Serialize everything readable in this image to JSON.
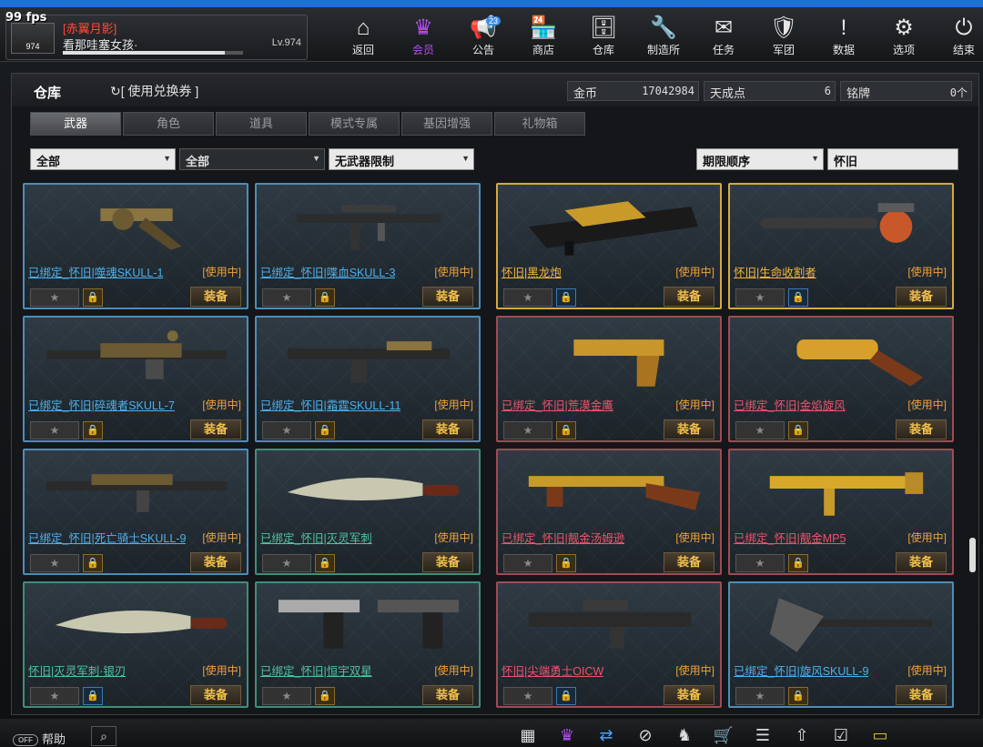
{
  "fps": "99 fps",
  "player": {
    "name": "[赤翼月影]",
    "sub": "看那哇塞女孩·",
    "level": "Lv.974",
    "avatar_level": "974"
  },
  "nav": [
    {
      "icon": "⌂",
      "label": "返回",
      "name": "back"
    },
    {
      "icon": "♛",
      "label": "会员",
      "name": "member"
    },
    {
      "icon": "📢",
      "label": "公告",
      "name": "notice",
      "badge": "23"
    },
    {
      "icon": "🏪",
      "label": "商店",
      "name": "shop"
    },
    {
      "icon": "🗄",
      "label": "仓库",
      "name": "storage"
    },
    {
      "icon": "🔧",
      "label": "制造所",
      "name": "workshop"
    },
    {
      "icon": "✉",
      "label": "任务",
      "name": "mission"
    },
    {
      "icon": "🛡",
      "label": "军团",
      "name": "clan"
    },
    {
      "icon": "!",
      "label": "数据",
      "name": "stats"
    },
    {
      "icon": "⚙",
      "label": "选项",
      "name": "options"
    },
    {
      "icon": "⏻",
      "label": "结束",
      "name": "exit"
    }
  ],
  "storage": {
    "title": "仓库",
    "coupon": "[ 使用兑换券 ]",
    "currency": [
      {
        "k": "金币",
        "v": "17042984"
      },
      {
        "k": "天成点",
        "v": "6"
      },
      {
        "k": "铭牌",
        "v": "0个"
      }
    ]
  },
  "tabs": [
    "武器",
    "角色",
    "道具",
    "模式专属",
    "基因增强",
    "礼物箱"
  ],
  "filters": {
    "f1": "全部",
    "f2": "全部",
    "f3": "无武器限制",
    "sort": "期限顺序",
    "search": "怀旧"
  },
  "items": [
    {
      "name": "已绑定_怀旧|噬魂SKULL-1",
      "status": "[使用中]",
      "equip": "装备",
      "star": "★",
      "border": "blue",
      "lock": "gold",
      "gun": "revolver"
    },
    {
      "name": "已绑定_怀旧|喋血SKULL-3",
      "status": "[使用中]",
      "equip": "装备",
      "star": "★",
      "border": "blue",
      "lock": "gold",
      "gun": "smg"
    },
    {
      "name": "怀旧|黑龙炮",
      "status": "[使用中]",
      "equip": "装备",
      "star": "★",
      "border": "gold",
      "lock": "blue",
      "gun": "cannon"
    },
    {
      "name": "怀旧|生命收割者",
      "status": "[使用中]",
      "equip": "装备",
      "star": "★",
      "border": "gold",
      "lock": "blue",
      "gun": "chainsaw"
    },
    {
      "name": "已绑定_怀旧|碎魂者SKULL-7",
      "status": "[使用中]",
      "equip": "装备",
      "star": "★",
      "border": "blue",
      "lock": "gold",
      "gun": "mg"
    },
    {
      "name": "已绑定_怀旧|霜霆SKULL-11",
      "status": "[使用中]",
      "equip": "装备",
      "star": "★",
      "border": "blue",
      "lock": "gold",
      "gun": "shotgun"
    },
    {
      "name": "已绑定_怀旧|荒漠金鹰",
      "status": "[使用中]",
      "equip": "装备",
      "star": "★",
      "border": "red",
      "lock": "gold",
      "gun": "pistol"
    },
    {
      "name": "已绑定_怀旧|金焰旋风",
      "status": "[使用中]",
      "equip": "装备",
      "star": "★",
      "border": "red",
      "lock": "gold",
      "gun": "launcher"
    },
    {
      "name": "已绑定_怀旧|死亡骑士SKULL-9",
      "status": "[使用中]",
      "equip": "装备",
      "star": "★",
      "border": "blue",
      "lock": "gold",
      "gun": "rifle"
    },
    {
      "name": "已绑定_怀旧|灭灵军刺",
      "status": "[使用中]",
      "equip": "装备",
      "star": "★",
      "border": "green",
      "lock": "gold",
      "gun": "knife"
    },
    {
      "name": "已绑定_怀旧|靓金汤姆逊",
      "status": "[使用中]",
      "equip": "装备",
      "star": "★",
      "border": "red",
      "lock": "gold",
      "gun": "thompson"
    },
    {
      "name": "已绑定_怀旧|靓金MP5",
      "status": "[使用中]",
      "equip": "装备",
      "star": "★",
      "border": "red",
      "lock": "gold",
      "gun": "mp5"
    },
    {
      "name": "怀旧|灭灵军刺·银刃",
      "status": "[使用中]",
      "equip": "装备",
      "star": "★",
      "border": "green",
      "lock": "blue",
      "gun": "knife"
    },
    {
      "name": "已绑定_怀旧|恒宇双星",
      "status": "[使用中]",
      "equip": "装备",
      "star": "★",
      "border": "green",
      "lock": "gold",
      "gun": "dual"
    },
    {
      "name": "怀旧|尖端勇士OICW",
      "status": "[使用中]",
      "equip": "装备",
      "star": "★",
      "border": "red",
      "lock": "blue",
      "gun": "oicw"
    },
    {
      "name": "已绑定_怀旧|旋风SKULL-9",
      "status": "[使用中]",
      "equip": "装备",
      "star": "★",
      "border": "blue",
      "lock": "gold",
      "gun": "axe"
    }
  ],
  "bottom": {
    "help": "帮助",
    "toggle": "OFF",
    "search_icon": "⌕",
    "icons": [
      {
        "i": "▦",
        "name": "calendar"
      },
      {
        "i": "♛",
        "name": "vip-cart",
        "c": "p"
      },
      {
        "i": "⇄",
        "name": "exchange",
        "c": "b"
      },
      {
        "i": "⊘",
        "name": "compass"
      },
      {
        "i": "♞",
        "name": "character"
      },
      {
        "i": "🛒",
        "name": "cart"
      },
      {
        "i": "☰",
        "name": "list"
      },
      {
        "i": "⇧",
        "name": "upgrade"
      },
      {
        "i": "☑",
        "name": "check"
      },
      {
        "i": "▭",
        "name": "card",
        "c": "g"
      }
    ]
  }
}
